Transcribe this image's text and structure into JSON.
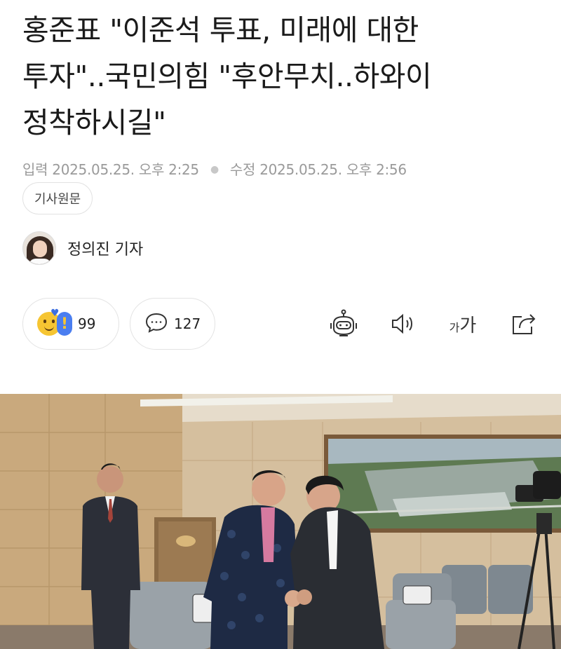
{
  "article": {
    "headline_lines": [
      "홍준표 \"이준석 투표, 미래에 대한",
      "투자\"..국민의힘 \"후안무치..하와이",
      "정착하시길\""
    ],
    "input_label": "입력",
    "input_time": "2025.05.25. 오후 2:25",
    "edit_label": "수정",
    "edit_time": "2025.05.25. 오후 2:56",
    "original_button": "기사원문",
    "reporter": "정의진 기자"
  },
  "actions": {
    "reaction_count": "99",
    "comment_count": "127",
    "font_icon_text_small": "가",
    "font_icon_text_large": "가"
  },
  "colors": {
    "meta_text": "#9a9a9a",
    "border": "#e3e3e3",
    "photo_wall": "#cfb796"
  },
  "icons": [
    "emotion-reaction-icon",
    "comment-icon",
    "ai-summary-robot-icon",
    "text-to-speech-icon",
    "font-size-icon",
    "share-icon"
  ]
}
